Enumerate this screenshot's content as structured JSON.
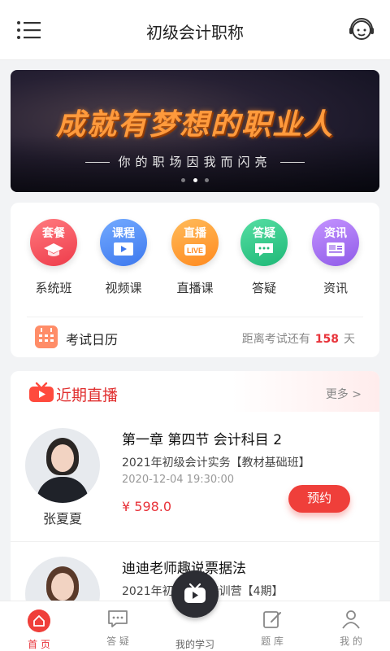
{
  "header": {
    "title": "初级会计职称"
  },
  "banner": {
    "headline": "成就有梦想的职业人",
    "subline": "你的职场因我而闪亮"
  },
  "categories": [
    {
      "tag": "套餐",
      "label": "系统班",
      "color": "#f3525b"
    },
    {
      "tag": "课程",
      "label": "视频课",
      "color": "#4f8ef5"
    },
    {
      "tag": "直播",
      "label": "直播课",
      "color": "#ff9a2e"
    },
    {
      "tag": "答疑",
      "label": "答疑",
      "color": "#32c88a"
    },
    {
      "tag": "资讯",
      "label": "资讯",
      "color": "#a86ef0"
    }
  ],
  "exam": {
    "label": "考试日历",
    "prefix": "距离考试还有",
    "days": "158",
    "suffix": "天"
  },
  "live": {
    "title": "近期直播",
    "more": "更多 >",
    "courses": [
      {
        "title": "第一章 第四节 会计科目 2",
        "subtitle": "2021年初级会计实务【教材基础班】",
        "time": "2020-12-04 19:30:00",
        "price": "¥ 598.0",
        "teacher": "张夏夏",
        "action": "预约"
      },
      {
        "title": "迪迪老师趣说票据法",
        "subtitle": "2021年初会先锋特训营【4期】"
      }
    ]
  },
  "tabbar": {
    "home": "首 页",
    "qa": "答 疑",
    "study": "我的学习",
    "bank": "题 库",
    "mine": "我 的"
  }
}
